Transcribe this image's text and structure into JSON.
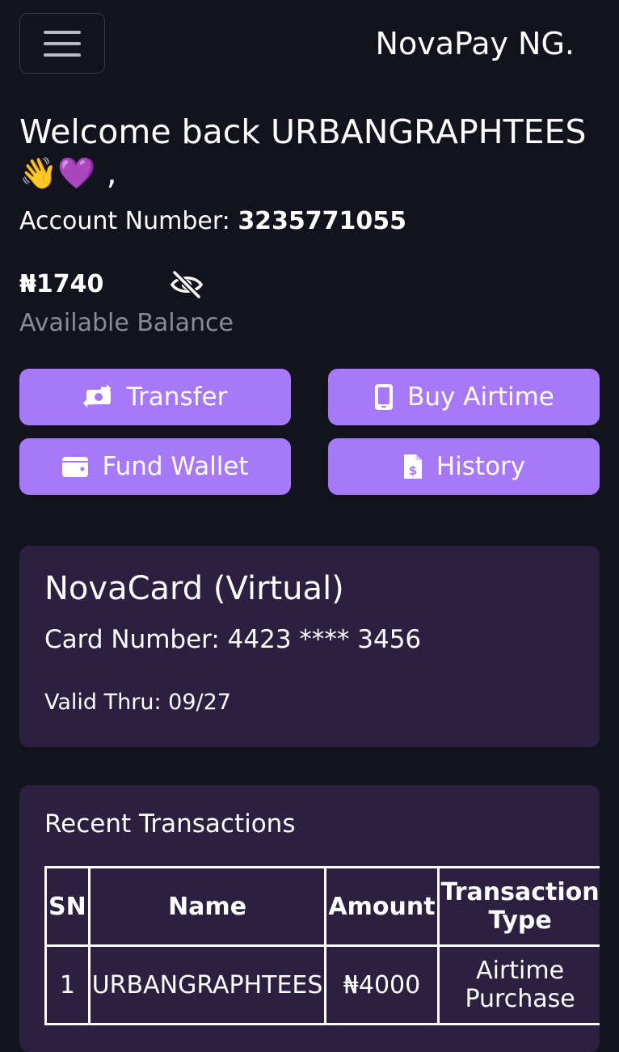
{
  "header": {
    "brand": "NovaPay NG."
  },
  "welcome": {
    "text": "Welcome back URBANGRAPHTEES",
    "emoji": "👋💜",
    "suffix": " ,"
  },
  "account": {
    "label": "Account Number:",
    "number": "3235771055"
  },
  "balance": {
    "amount": "₦1740",
    "label": "Available Balance"
  },
  "actions": {
    "transfer": "Transfer",
    "buy_airtime": "Buy Airtime",
    "fund_wallet": "Fund Wallet",
    "history": "History"
  },
  "card": {
    "title": "NovaCard (Virtual)",
    "number": "Card Number: 4423 **** 3456",
    "valid": "Valid Thru: 09/27"
  },
  "transactions": {
    "title": "Recent Transactions",
    "headers": [
      "SN",
      "Name",
      "Amount",
      "Transaction Type"
    ],
    "rows": [
      [
        "1",
        "URBANGRAPHTEES",
        "₦4000",
        "Airtime Purchase"
      ]
    ]
  },
  "colors": {
    "background": "#13131f",
    "accent": "#a779f9",
    "card": "#2b2040"
  }
}
